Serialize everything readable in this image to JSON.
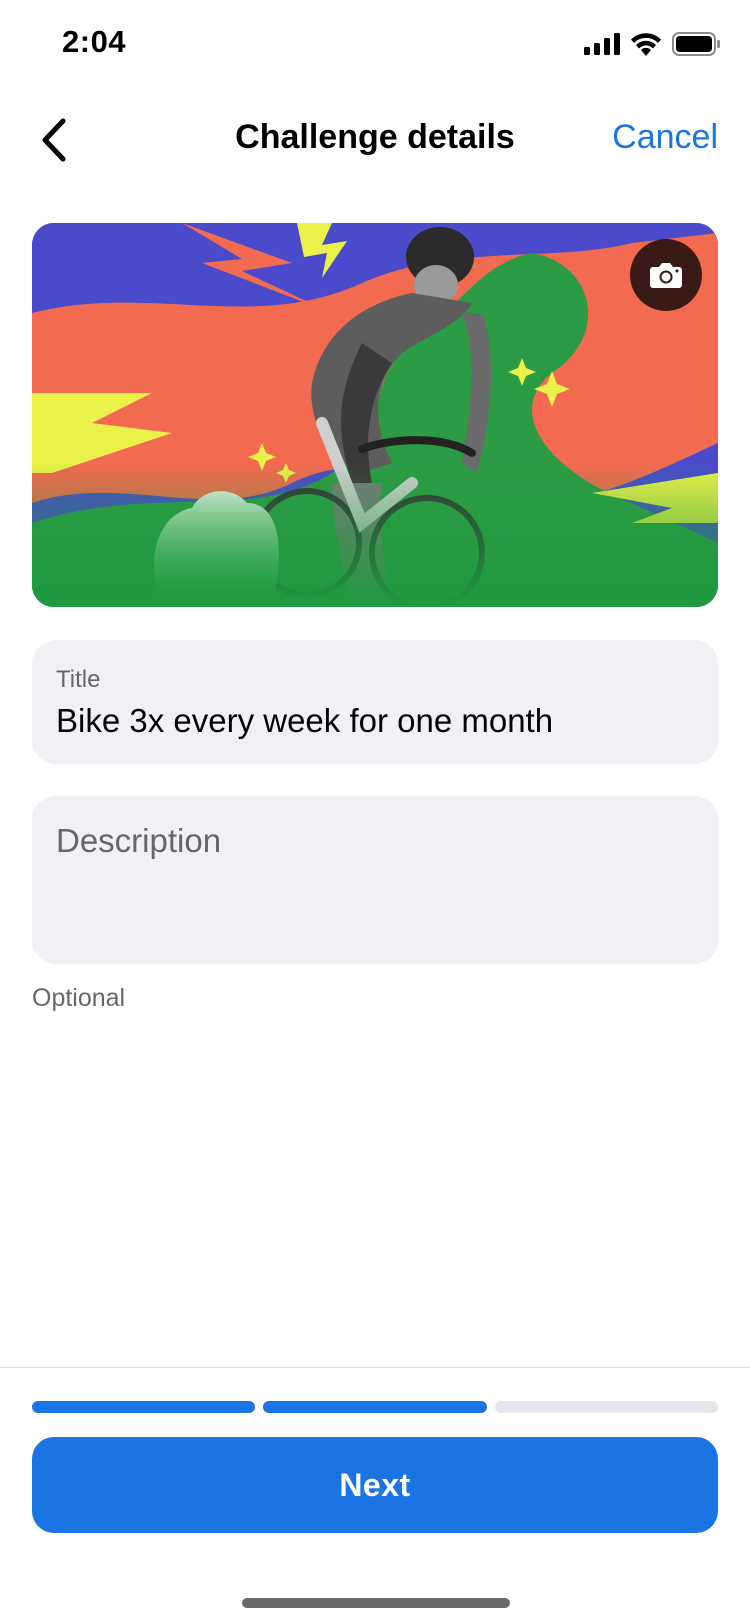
{
  "status_bar": {
    "time": "2:04",
    "icons": [
      "signal-icon",
      "wifi-icon",
      "battery-icon"
    ]
  },
  "nav": {
    "title": "Challenge details",
    "cancel_label": "Cancel",
    "back_icon": "chevron-left-icon"
  },
  "banner": {
    "image": "cyclist-illustration",
    "camera_icon": "camera-icon"
  },
  "form": {
    "title_label": "Title",
    "title_value": "Bike 3x every week for one month",
    "description_placeholder": "Description",
    "description_helper": "Optional"
  },
  "progress": {
    "steps_total": 3,
    "steps_completed": 2
  },
  "footer": {
    "next_label": "Next"
  },
  "colors": {
    "accent": "#1b74e4",
    "field_bg": "#f0f1f4",
    "muted_text": "#65676b"
  }
}
